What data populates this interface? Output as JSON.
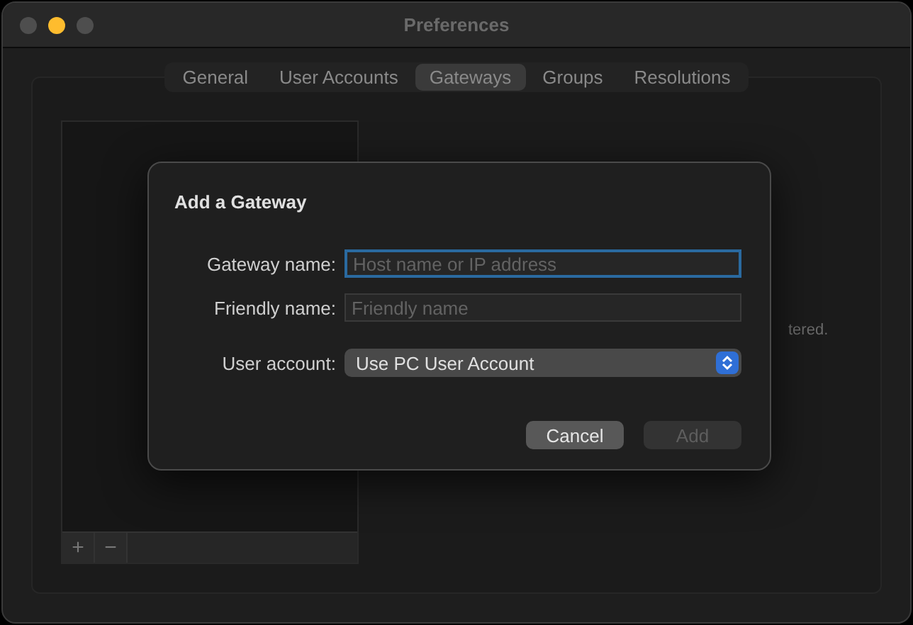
{
  "window": {
    "title": "Preferences",
    "lights": [
      {
        "color": "#4e4e4e"
      },
      {
        "color": "#febc2e"
      },
      {
        "color": "#4e4e4e"
      }
    ]
  },
  "tabs": [
    {
      "label": "General",
      "selected": false
    },
    {
      "label": "User Accounts",
      "selected": false
    },
    {
      "label": "Gateways",
      "selected": true
    },
    {
      "label": "Groups",
      "selected": false
    },
    {
      "label": "Resolutions",
      "selected": false
    }
  ],
  "list_toolbar": {
    "add": "+",
    "remove": "−"
  },
  "background_text": "tered.",
  "dialog": {
    "title": "Add a Gateway",
    "fields": [
      {
        "kind": "text",
        "label": "Gateway name:",
        "placeholder": "Host name or IP address",
        "focused": true
      },
      {
        "kind": "text",
        "label": "Friendly name:",
        "placeholder": "Friendly name",
        "focused": false
      },
      {
        "kind": "select",
        "label": "User account:",
        "value": "Use PC User Account"
      }
    ],
    "buttons": [
      {
        "label": "Cancel",
        "disabled": false
      },
      {
        "label": "Add",
        "disabled": true
      }
    ]
  }
}
